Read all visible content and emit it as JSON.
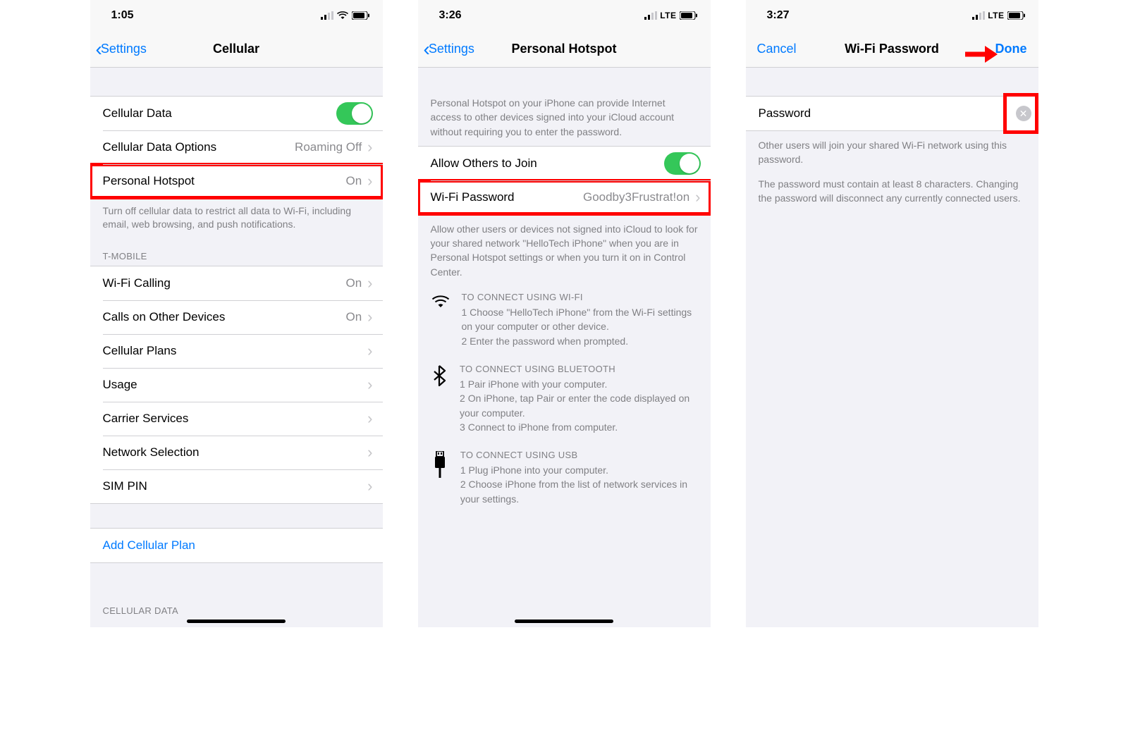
{
  "screen1": {
    "time": "1:05",
    "back": "Settings",
    "title": "Cellular",
    "rows": {
      "cellular_data": "Cellular Data",
      "cellular_data_options": {
        "label": "Cellular Data Options",
        "value": "Roaming Off"
      },
      "personal_hotspot": {
        "label": "Personal Hotspot",
        "value": "On"
      }
    },
    "note1": "Turn off cellular data to restrict all data to Wi-Fi, including email, web browsing, and push notifications.",
    "carrier_header": "T-MOBILE",
    "rows2": {
      "wifi_calling": {
        "label": "Wi-Fi Calling",
        "value": "On"
      },
      "calls_other": {
        "label": "Calls on Other Devices",
        "value": "On"
      },
      "cellular_plans": {
        "label": "Cellular Plans",
        "value": ""
      },
      "usage": {
        "label": "Usage",
        "value": ""
      },
      "carrier_services": {
        "label": "Carrier Services",
        "value": ""
      },
      "network_selection": {
        "label": "Network Selection",
        "value": ""
      },
      "sim_pin": {
        "label": "SIM PIN",
        "value": ""
      }
    },
    "add_plan": "Add Cellular Plan",
    "footer_header": "CELLULAR DATA"
  },
  "screen2": {
    "time": "3:26",
    "net": "LTE",
    "back": "Settings",
    "title": "Personal Hotspot",
    "intro": "Personal Hotspot on your iPhone can provide Internet access to other devices signed into your iCloud account without requiring you to enter the password.",
    "rows": {
      "allow_others": "Allow Others to Join",
      "wifi_password": {
        "label": "Wi-Fi Password",
        "value": "Goodby3Frustrat!on"
      }
    },
    "note2": "Allow other users or devices not signed into iCloud to look for your shared network \"HelloTech iPhone\" when you are in Personal Hotspot settings or when you turn it on in Control Center.",
    "wifi": {
      "hdr": "TO CONNECT USING WI-FI",
      "l1": "1 Choose \"HelloTech iPhone\" from the Wi-Fi settings on your computer or other device.",
      "l2": "2 Enter the password when prompted."
    },
    "bt": {
      "hdr": "TO CONNECT USING BLUETOOTH",
      "l1": "1 Pair iPhone with your computer.",
      "l2": "2 On iPhone, tap Pair or enter the code displayed on your computer.",
      "l3": "3 Connect to iPhone from computer."
    },
    "usb": {
      "hdr": "TO CONNECT USING USB",
      "l1": "1 Plug iPhone into your computer.",
      "l2": "2 Choose iPhone from the list of network services in your settings."
    }
  },
  "screen3": {
    "time": "3:27",
    "net": "LTE",
    "cancel": "Cancel",
    "title": "Wi-Fi Password",
    "done": "Done",
    "password_label": "Password",
    "note1": "Other users will join your shared Wi-Fi network using this password.",
    "note2": "The password must contain at least 8 characters. Changing the password will disconnect any currently connected users."
  }
}
